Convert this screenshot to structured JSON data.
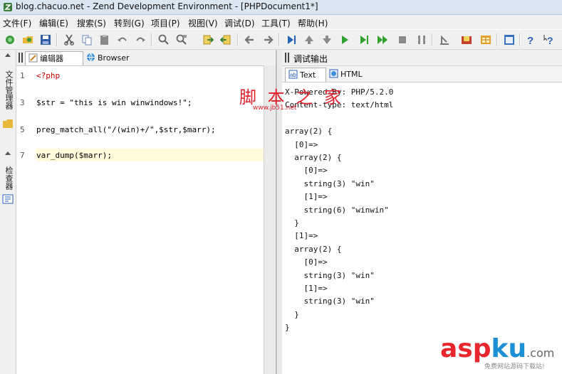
{
  "window": {
    "title": "blog.chacuo.net - Zend Development Environment - [PHPDocument1*]"
  },
  "menu": [
    "文件(F)",
    "编辑(E)",
    "搜索(S)",
    "转到(G)",
    "项目(P)",
    "视图(V)",
    "调试(D)",
    "工具(T)",
    "帮助(H)"
  ],
  "toolbar": {
    "buttons": [
      "new-file-icon",
      "open-folder-icon",
      "save-icon",
      "cut-icon",
      "copy-icon",
      "paste-icon",
      "undo-icon",
      "redo-icon",
      "find-icon",
      "find-replace-icon",
      "goto-icon",
      "indent-icon",
      "back-arrow-icon",
      "forward-arrow-icon",
      "step-icon",
      "up-arrow-icon",
      "down-arrow-icon",
      "run-icon",
      "run-to-icon",
      "run-fast-icon",
      "stop-icon",
      "pause-icon",
      "profile-icon",
      "folder-star-icon",
      "calendar-icon",
      "help-icon",
      "context-help-icon"
    ]
  },
  "left_strip": {
    "tab1": "文件管理器",
    "tab2": "检查器"
  },
  "editor": {
    "tabs": [
      "编辑器",
      "Browser"
    ],
    "line_numbers": [
      "1",
      "3",
      "5",
      "7"
    ],
    "lines": [
      {
        "text": "<?php",
        "color": "#cc0000"
      },
      {
        "text": "$str = \"this is win winwindows!\";",
        "color": "#000000"
      },
      {
        "text": "preg_match_all(\"/(win)+/\",$str,$marr);",
        "color": "#000000"
      },
      {
        "text": "var_dump($marr);",
        "color": "#000000"
      }
    ]
  },
  "debug": {
    "title": "调试输出",
    "tabs": [
      "Text",
      "HTML"
    ],
    "output": [
      "X-Powered-By: PHP/5.2.0",
      "Content-type: text/html",
      "",
      "array(2) {",
      "  [0]=>",
      "  array(2) {",
      "    [0]=>",
      "    string(3) \"win\"",
      "    [1]=>",
      "    string(6) \"winwin\"",
      "  }",
      "  [1]=>",
      "  array(2) {",
      "    [0]=>",
      "    string(3) \"win\"",
      "    [1]=>",
      "    string(3) \"win\"",
      "  }",
      "}"
    ]
  },
  "watermark": {
    "top_cn": "脚 本 之 家",
    "top_url": "www.jb51.net",
    "brand_a": "asp",
    "brand_b": "ku",
    "brand_c": ".com",
    "brand_sub": "免费网站源码下载站!"
  },
  "colors": {
    "keyword": "#cc0000",
    "highlight": "#fffadc",
    "watermark_red": "#e0202a",
    "watermark_blue": "#1d8fd4"
  }
}
